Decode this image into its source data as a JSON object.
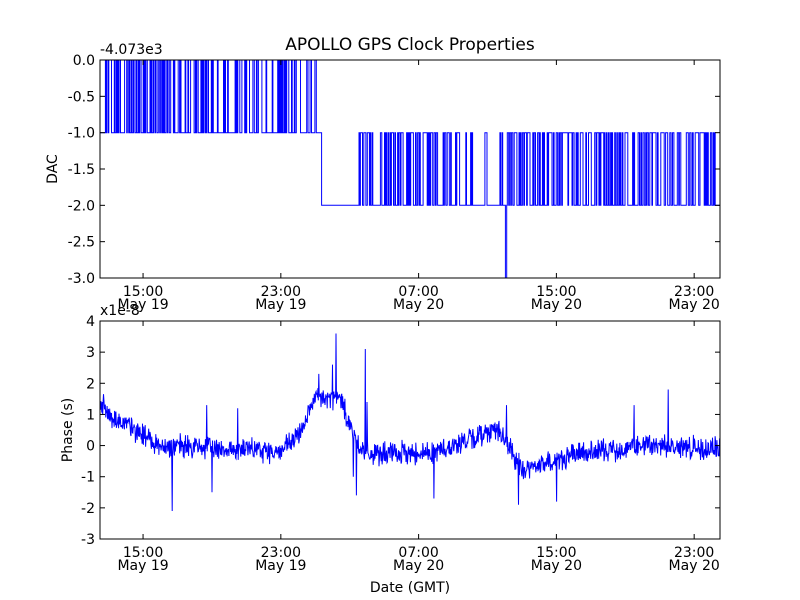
{
  "chart_data": [
    {
      "type": "line",
      "title": "APOLLO GPS Clock Properties",
      "ylabel": "DAC",
      "xlabel": "",
      "offset_label": "-4.073e3",
      "ylim": [
        -3.0,
        0.0
      ],
      "y_ticks": [
        "0.0",
        "-0.5",
        "-1.0",
        "-1.5",
        "-2.0",
        "-2.5",
        "-3.0"
      ],
      "x_ticks": [
        {
          "time": "15:00",
          "date": "May 19"
        },
        {
          "time": "23:00",
          "date": "May 19"
        },
        {
          "time": "07:00",
          "date": "May 20"
        },
        {
          "time": "15:00",
          "date": "May 20"
        },
        {
          "time": "23:00",
          "date": "May 20"
        }
      ],
      "xlim_hours": [
        12.5,
        48.5
      ],
      "color": "#0000ff",
      "segments": [
        {
          "start": 12.5,
          "end": 12.85,
          "level": -1,
          "alt": 0,
          "toggle_prob": 0.25
        },
        {
          "start": 12.85,
          "end": 19.0,
          "level": -1,
          "alt": 0,
          "toggle_prob": 0.45
        },
        {
          "start": 19.0,
          "end": 20.5,
          "level": -1,
          "alt": 0,
          "toggle_prob": 0.15
        },
        {
          "start": 20.5,
          "end": 25.1,
          "level": -1,
          "alt": 0,
          "toggle_prob": 0.4
        },
        {
          "start": 25.1,
          "end": 25.6,
          "level": -1,
          "alt": -2,
          "toggle_prob": 0.0
        },
        {
          "start": 25.6,
          "end": 27.5,
          "level": -2,
          "alt": -1,
          "toggle_prob": 0.0
        },
        {
          "start": 27.5,
          "end": 33.5,
          "level": -2,
          "alt": -1,
          "toggle_prob": 0.45
        },
        {
          "start": 33.5,
          "end": 36.0,
          "level": -2,
          "alt": -1,
          "toggle_prob": 0.05
        },
        {
          "start": 36.0,
          "end": 36.15,
          "level": -3,
          "alt": -2,
          "toggle_prob": 0.0
        },
        {
          "start": 36.15,
          "end": 48.5,
          "level": -2,
          "alt": -1,
          "toggle_prob": 0.45
        }
      ]
    },
    {
      "type": "line",
      "title": "",
      "ylabel": "Phase (s)",
      "xlabel": "Date (GMT)",
      "offset_label": "x1e-8",
      "ylim": [
        -3,
        4
      ],
      "y_ticks": [
        "4",
        "3",
        "2",
        "1",
        "0",
        "-1",
        "-2",
        "-3"
      ],
      "x_ticks": [
        {
          "time": "15:00",
          "date": "May 19"
        },
        {
          "time": "23:00",
          "date": "May 19"
        },
        {
          "time": "07:00",
          "date": "May 20"
        },
        {
          "time": "15:00",
          "date": "May 20"
        },
        {
          "time": "23:00",
          "date": "May 20"
        }
      ],
      "xlim_hours": [
        12.5,
        48.5
      ],
      "color": "#0000ff",
      "baseline": [
        [
          12.5,
          1.4
        ],
        [
          13.0,
          1.0
        ],
        [
          14.5,
          0.5
        ],
        [
          16.0,
          0.0
        ],
        [
          20.0,
          -0.1
        ],
        [
          23.0,
          -0.2
        ],
        [
          24.0,
          0.3
        ],
        [
          25.0,
          1.5
        ],
        [
          26.5,
          1.5
        ],
        [
          27.3,
          0.2
        ],
        [
          28.0,
          -0.3
        ],
        [
          32.0,
          -0.2
        ],
        [
          34.5,
          0.3
        ],
        [
          35.5,
          0.6
        ],
        [
          36.5,
          -0.3
        ],
        [
          37.0,
          -0.8
        ],
        [
          40.0,
          -0.3
        ],
        [
          44.0,
          0.0
        ],
        [
          48.5,
          -0.1
        ]
      ],
      "spikes": [
        {
          "x": 16.7,
          "y": -2.1
        },
        {
          "x": 18.7,
          "y": 1.3
        },
        {
          "x": 19.0,
          "y": -1.5
        },
        {
          "x": 20.5,
          "y": 1.2
        },
        {
          "x": 25.2,
          "y": 2.3
        },
        {
          "x": 26.0,
          "y": 2.6
        },
        {
          "x": 26.2,
          "y": 3.6
        },
        {
          "x": 26.5,
          "y": 1.2
        },
        {
          "x": 27.2,
          "y": -1.0
        },
        {
          "x": 27.4,
          "y": -1.6
        },
        {
          "x": 27.9,
          "y": 3.1
        },
        {
          "x": 28.0,
          "y": 1.4
        },
        {
          "x": 31.9,
          "y": -1.7
        },
        {
          "x": 36.1,
          "y": 1.3
        },
        {
          "x": 36.8,
          "y": -1.9
        },
        {
          "x": 39.0,
          "y": -1.8
        },
        {
          "x": 43.5,
          "y": 1.3
        },
        {
          "x": 45.5,
          "y": 1.8
        }
      ],
      "noise": 0.28
    }
  ]
}
